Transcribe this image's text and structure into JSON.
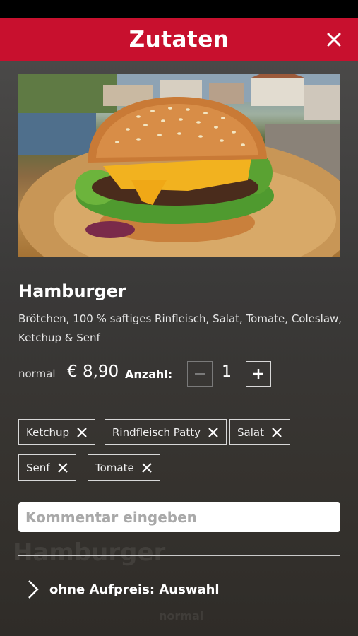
{
  "header": {
    "title": "Zutaten",
    "close_icon": "close-icon"
  },
  "product": {
    "name": "Hamburger",
    "description": "Brötchen, 100 % saftiges Rinfleisch, Salat, Tomate, Coleslaw, Ketchup & Senf",
    "size_label": "normal",
    "price": "€ 8,90",
    "quantity_label": "Anzahl:",
    "quantity": "1"
  },
  "ingredients": [
    {
      "label": "Ketchup"
    },
    {
      "label": "Rindfleisch Patty"
    },
    {
      "label": "Salat"
    },
    {
      "label": "Senf"
    },
    {
      "label": "Tomate"
    }
  ],
  "comment": {
    "placeholder": "Kommentar eingeben",
    "value": ""
  },
  "options": {
    "label": "ohne Aufpreis: Auswahl"
  },
  "background_ghost": {
    "title": "Hamburger",
    "size": "normal"
  },
  "colors": {
    "accent": "#c8102e",
    "background": "#3b3a39"
  }
}
